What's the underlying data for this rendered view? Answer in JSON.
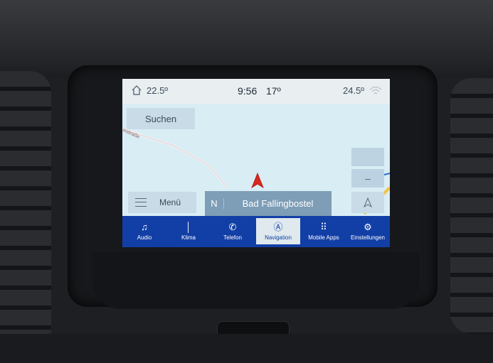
{
  "status": {
    "outside_temp": "22.5º",
    "time": "9:56",
    "time_temp": "17º",
    "inside_temp": "24.5º"
  },
  "map": {
    "search_label": "Suchen",
    "street_label": "instraße",
    "menu_label": "Menü",
    "heading": "N",
    "location": "Bad Fallingbostel"
  },
  "tabs": [
    {
      "label": "Audio",
      "icon": "music-note-icon",
      "glyph": "♫"
    },
    {
      "label": "Klima",
      "icon": "thermometer-icon",
      "glyph": "🌡"
    },
    {
      "label": "Telefon",
      "icon": "phone-icon",
      "glyph": "✆"
    },
    {
      "label": "Navigation",
      "icon": "navigation-icon",
      "glyph": "Ⓐ"
    },
    {
      "label": "Mobile Apps",
      "icon": "apps-grid-icon",
      "glyph": "⠿"
    },
    {
      "label": "Einstellungen",
      "icon": "gear-icon",
      "glyph": "⚙"
    }
  ],
  "colors": {
    "bottom_bar": "#123fa6",
    "location_bar": "#7e9db6",
    "nav_arrow": "#d9281e"
  }
}
